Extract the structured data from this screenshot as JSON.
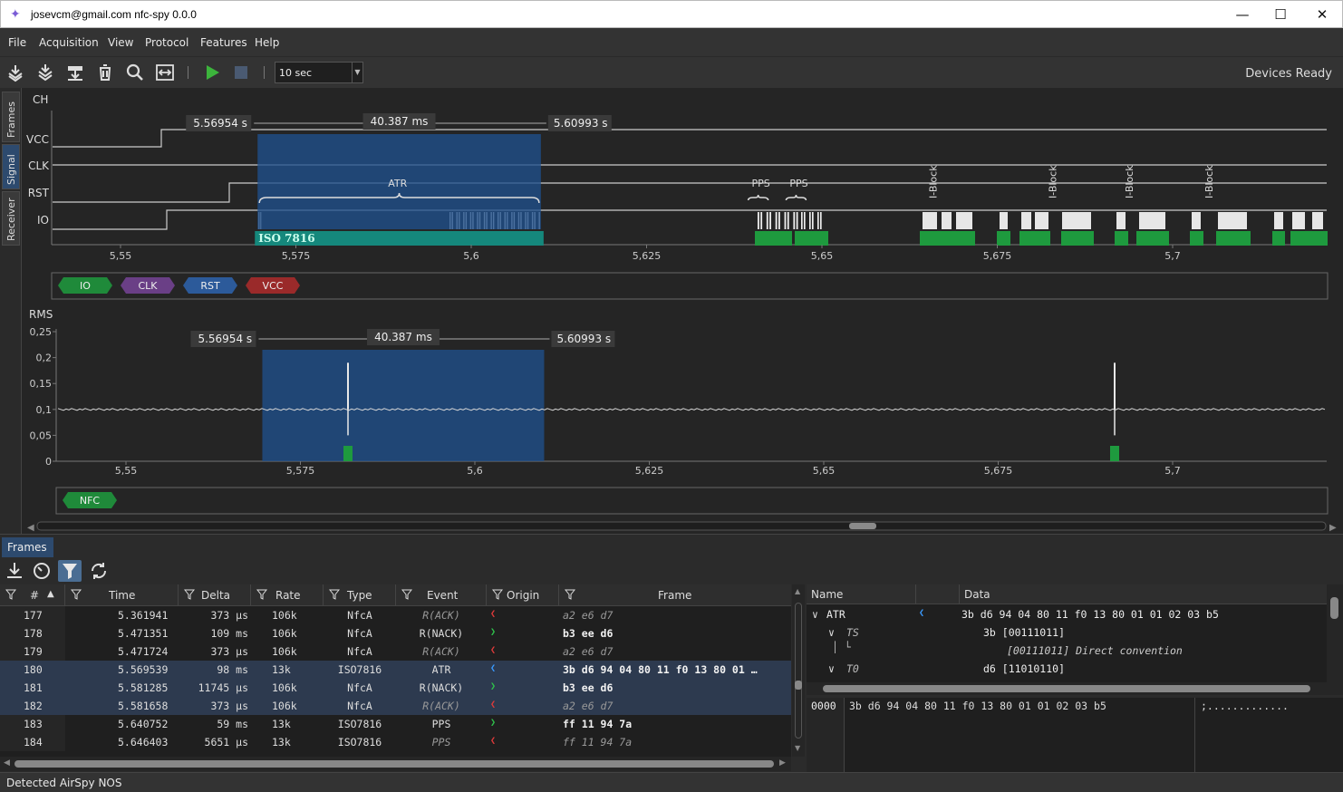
{
  "window": {
    "title": "josevcm@gmail.com nfc-spy 0.0.0"
  },
  "menu": [
    "File",
    "Acquisition",
    "View",
    "Protocol",
    "Features",
    "Help"
  ],
  "toolbar": {
    "time_window": "10 sec",
    "status": "Devices Ready"
  },
  "side_tabs": [
    "Frames",
    "Signal",
    "Receiver"
  ],
  "signal": {
    "axis_label": "CH",
    "channels": [
      "VCC",
      "CLK",
      "RST",
      "IO"
    ],
    "cursor_left": "5.56954 s",
    "cursor_span": "40.387 ms",
    "cursor_right": "5.60993 s",
    "x_ticks": [
      "5,55",
      "5,575",
      "5,6",
      "5,625",
      "5,65",
      "5,675",
      "5,7"
    ],
    "x_range": [
      5.545,
      5.715
    ],
    "selection": [
      5.56954,
      5.60993
    ],
    "annotations": [
      {
        "text": "ATR",
        "x": 5.5895
      },
      {
        "text": "PPS",
        "x": 5.6413
      },
      {
        "text": "PPS",
        "x": 5.6467
      },
      {
        "text": "I-Block",
        "x": 5.6658
      },
      {
        "text": "I-Block",
        "x": 5.6829
      },
      {
        "text": "I-Block",
        "x": 5.6938
      },
      {
        "text": "I-Block",
        "x": 5.7052
      }
    ],
    "protocol_bar": "ISO 7816",
    "legend": [
      {
        "label": "IO",
        "color": "#1f8a3a"
      },
      {
        "label": "CLK",
        "color": "#6a3f86"
      },
      {
        "label": "RST",
        "color": "#2c5a9a"
      },
      {
        "label": "VCC",
        "color": "#9a2a2a"
      }
    ]
  },
  "receiver": {
    "axis_label": "RMS",
    "y_ticks": [
      "0,25",
      "0,2",
      "0,15",
      "0,1",
      "0,05",
      "0"
    ],
    "y_range": [
      0,
      0.25
    ],
    "baseline": 0.1,
    "cursor_left": "5.56954 s",
    "cursor_span": "40.387 ms",
    "cursor_right": "5.60993 s",
    "x_ticks": [
      "5,55",
      "5,575",
      "5,6",
      "5,625",
      "5,65",
      "5,675",
      "5,7"
    ],
    "legend": [
      {
        "label": "NFC",
        "color": "#1f8a3a"
      }
    ]
  },
  "frames_tab": "Frames",
  "table": {
    "columns": [
      "#",
      "Time",
      "Delta",
      "Rate",
      "Type",
      "Event",
      "Origin",
      "Frame"
    ],
    "rows": [
      {
        "n": "177",
        "time": "5.361941",
        "delta": "373 µs",
        "rate": "106k",
        "type": "NfcA",
        "event": "R(ACK)",
        "origin": "red",
        "frame": "a2 e6 d7",
        "dim": true,
        "sel": false
      },
      {
        "n": "178",
        "time": "5.471351",
        "delta": "109 ms",
        "rate": "106k",
        "type": "NfcA",
        "event": "R(NACK)",
        "origin": "green",
        "frame": "b3 ee d6",
        "dim": false,
        "sel": false
      },
      {
        "n": "179",
        "time": "5.471724",
        "delta": "373 µs",
        "rate": "106k",
        "type": "NfcA",
        "event": "R(ACK)",
        "origin": "red",
        "frame": "a2 e6 d7",
        "dim": true,
        "sel": false
      },
      {
        "n": "180",
        "time": "5.569539",
        "delta": "98 ms",
        "rate": "13k",
        "type": "ISO7816",
        "event": "ATR",
        "origin": "blue",
        "frame": "3b d6 94 04 80 11 f0 13 80 01 …",
        "dim": false,
        "sel": true
      },
      {
        "n": "181",
        "time": "5.581285",
        "delta": "11745 µs",
        "rate": "106k",
        "type": "NfcA",
        "event": "R(NACK)",
        "origin": "green",
        "frame": "b3 ee d6",
        "dim": false,
        "sel": true
      },
      {
        "n": "182",
        "time": "5.581658",
        "delta": "373 µs",
        "rate": "106k",
        "type": "NfcA",
        "event": "R(ACK)",
        "origin": "red",
        "frame": "a2 e6 d7",
        "dim": true,
        "sel": true
      },
      {
        "n": "183",
        "time": "5.640752",
        "delta": "59 ms",
        "rate": "13k",
        "type": "ISO7816",
        "event": "PPS",
        "origin": "green",
        "frame": "ff 11 94 7a",
        "dim": false,
        "sel": false
      },
      {
        "n": "184",
        "time": "5.646403",
        "delta": "5651 µs",
        "rate": "13k",
        "type": "ISO7816",
        "event": "PPS",
        "origin": "red",
        "frame": "ff 11 94 7a",
        "dim": true,
        "sel": false
      }
    ]
  },
  "tree": {
    "headers": [
      "Name",
      "Data"
    ],
    "rows": [
      {
        "name": "ATR",
        "data": "3b d6 94 04 80 11 f0 13 80 01 01 02 03 b5"
      },
      {
        "name": "TS",
        "data": "3b [00111011]"
      },
      {
        "name": "",
        "data": "[00111011] Direct convention"
      },
      {
        "name": "T0",
        "data": "d6 [11010110]"
      }
    ]
  },
  "hexview": {
    "offset": "0000",
    "bytes": "3b d6 94 04 80 11 f0 13 80 01 01 02 03 b5",
    "ascii": ";............."
  },
  "statusbar": "Detected AirSpy NOS"
}
